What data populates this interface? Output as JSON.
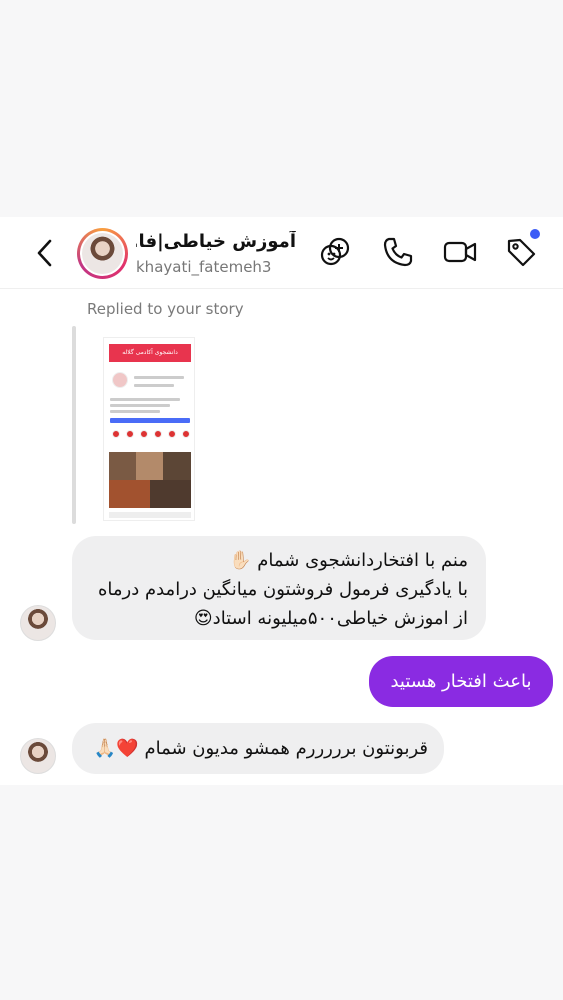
{
  "header": {
    "name": "آموزش خیاطی|فا...",
    "username": "khayati_fatemeh3",
    "icons": [
      "back-arrow-icon",
      "add-person-icon",
      "phone-icon",
      "video-camera-icon",
      "tag-icon"
    ],
    "badge_color": "#3b5bf6"
  },
  "story": {
    "label": "Replied to your story",
    "banner_text": "دانشجوی آکادمی گلاله"
  },
  "messages": [
    {
      "direction": "incoming",
      "text": "منم با افتخاردانشجوی شمام ✋🏻\nبا یادگیری فرمول فروشتون میانگین درامدم درماه\nاز اموزش خیاطی۵۰۰میلیونه استاد😍"
    },
    {
      "direction": "outgoing",
      "text": "باعث افتخار هستید"
    },
    {
      "direction": "incoming",
      "text": "قربونتون برررررم همشو مدیون شمام ❤️🙏🏻"
    }
  ],
  "colors": {
    "outgoing_bubble": "#8a2be2",
    "incoming_bubble": "#efeff0"
  }
}
